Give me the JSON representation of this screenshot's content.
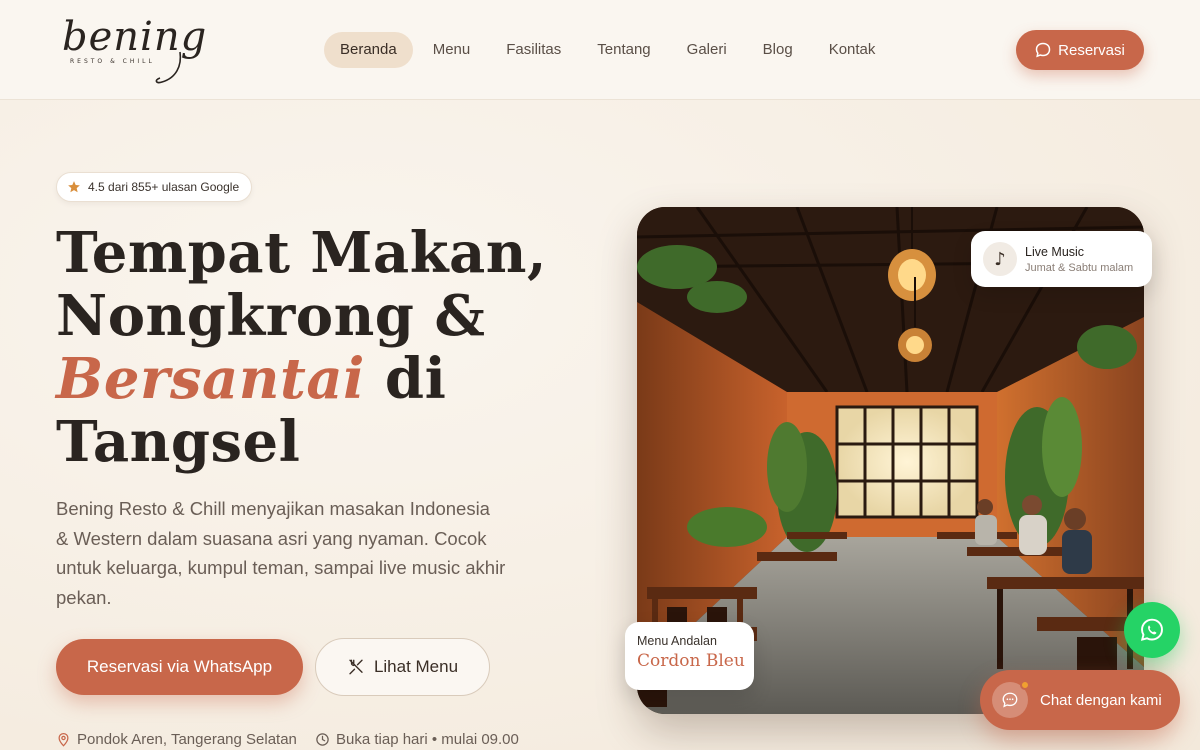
{
  "brand": {
    "name": "bening",
    "tagline": "RESTO & CHILL"
  },
  "nav": {
    "items": [
      {
        "label": "Beranda",
        "active": true
      },
      {
        "label": "Menu",
        "active": false
      },
      {
        "label": "Fasilitas",
        "active": false
      },
      {
        "label": "Tentang",
        "active": false
      },
      {
        "label": "Galeri",
        "active": false
      },
      {
        "label": "Blog",
        "active": false
      },
      {
        "label": "Kontak",
        "active": false
      }
    ],
    "cta_label": "Reservasi"
  },
  "hero": {
    "rating_text": "4.5 dari 855+ ulasan Google",
    "title_line1": "Tempat Makan,",
    "title_line2": "Nongkrong &",
    "title_accent": "Bersantai",
    "title_line3_rest": " di",
    "title_line4": "Tangsel",
    "description": "Bening Resto & Chill menyajikan masakan Indonesia & Western dalam suasana asri yang nyaman. Cocok untuk keluarga, kumpul teman, sampai live music akhir pekan.",
    "primary_cta": "Reservasi via WhatsApp",
    "secondary_cta": "Lihat Menu",
    "location": "Pondok Aren, Tangerang Selatan",
    "hours": "Buka tiap hari • mulai 09.00"
  },
  "cards": {
    "music_title": "Live Music",
    "music_sub": "Jumat & Sabtu malam",
    "menu_label": "Menu Andalan",
    "menu_value": "Cordon Bleu"
  },
  "chat": {
    "label": "Chat dengan kami"
  },
  "colors": {
    "accent": "#c8674a",
    "whatsapp": "#25d366",
    "background": "#f7f0e6"
  },
  "icons": [
    "star-icon",
    "chat-bubble-icon",
    "utensils-icon",
    "map-pin-icon",
    "clock-icon",
    "music-note-icon",
    "whatsapp-icon"
  ]
}
